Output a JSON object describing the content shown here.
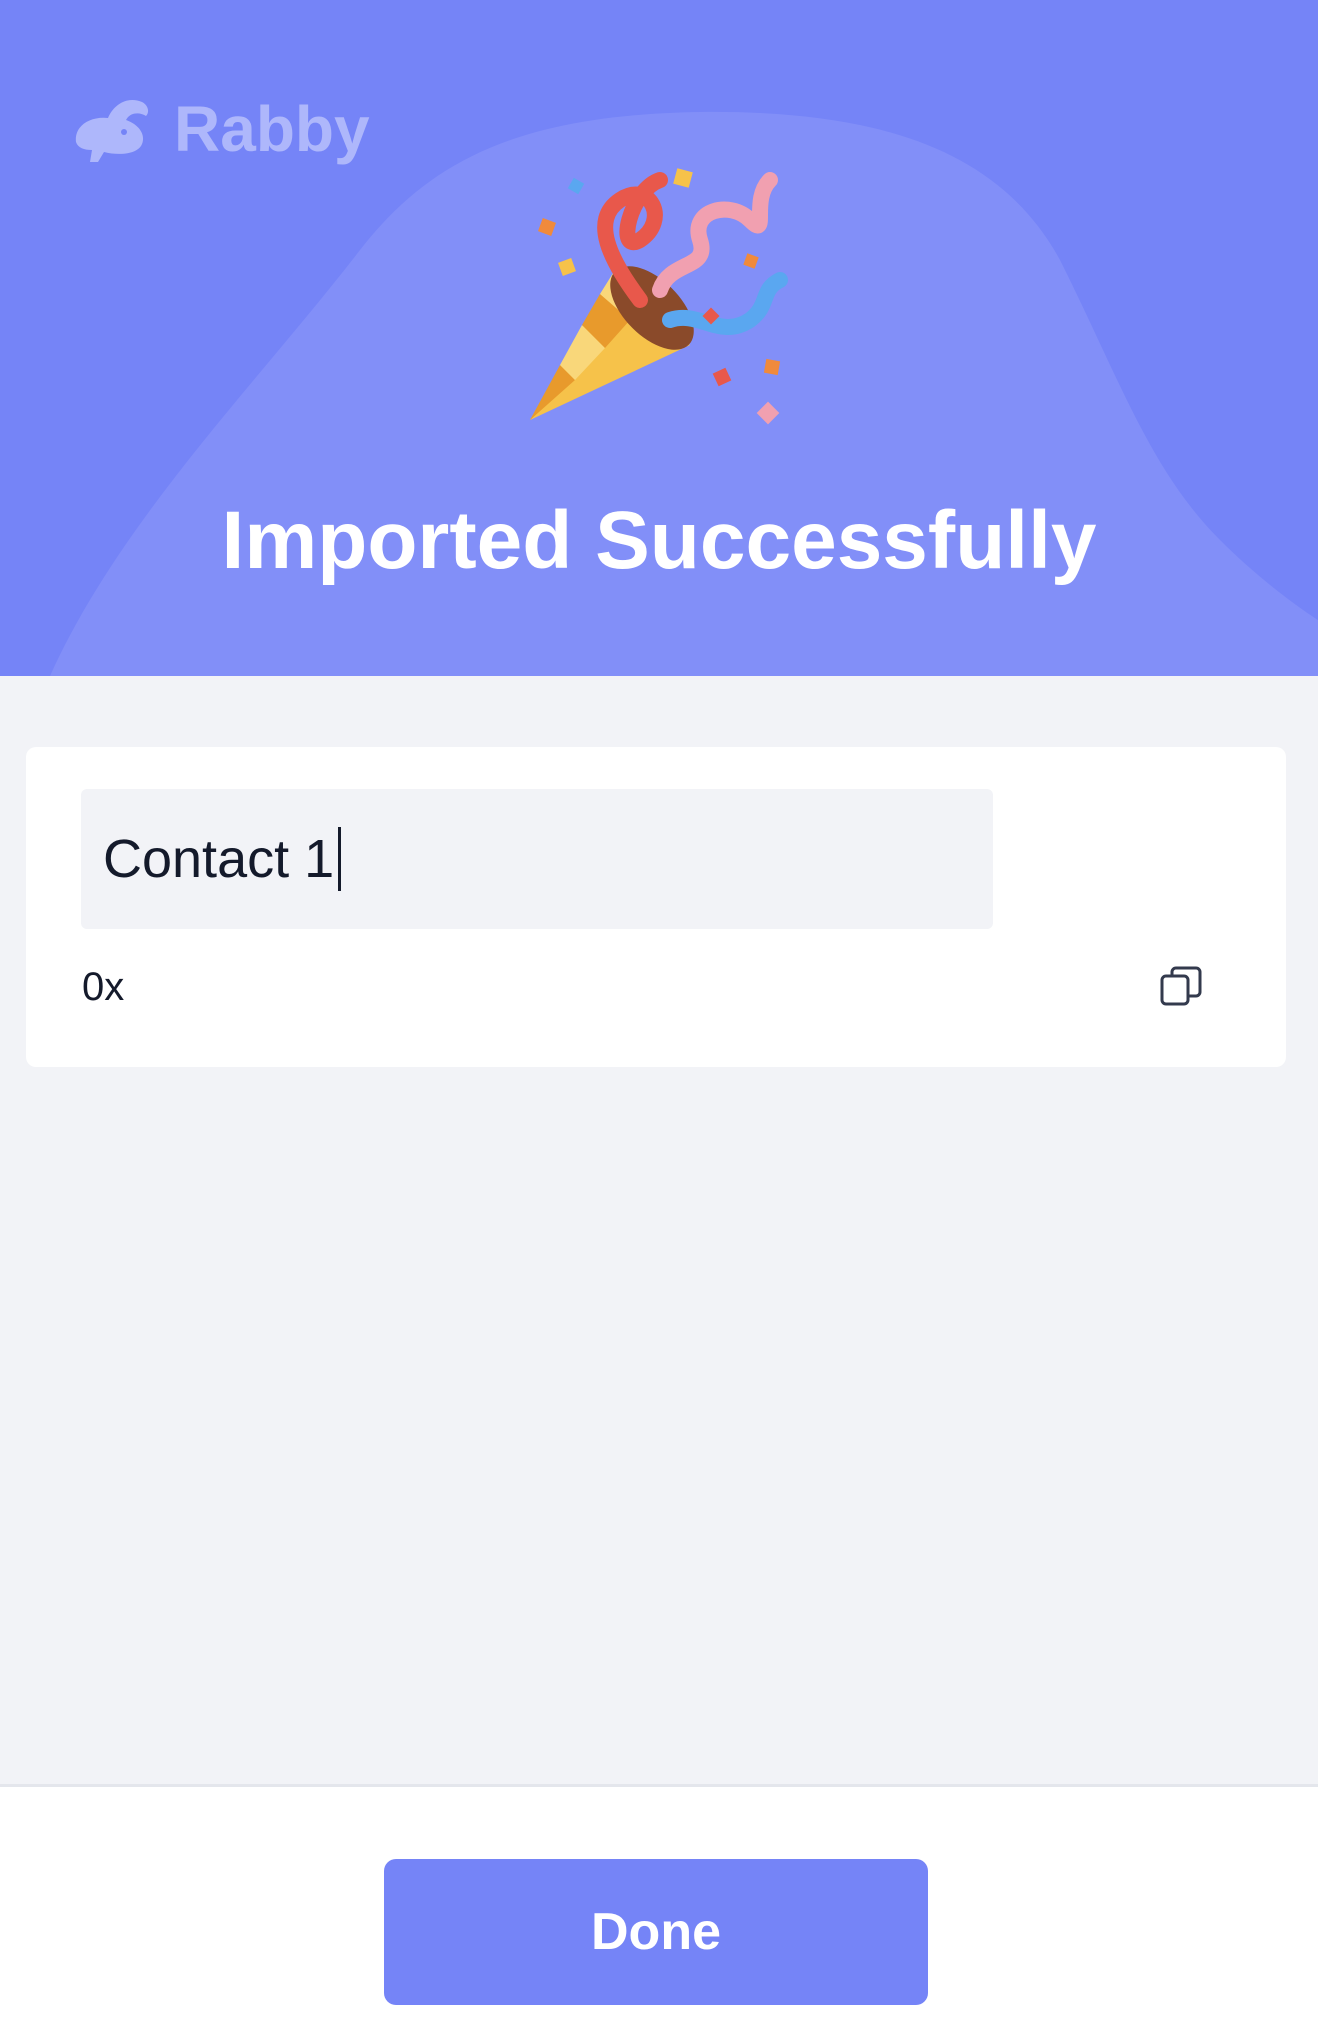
{
  "app": {
    "brand_name": "Rabby",
    "logo_icon": "rabbit-logo-icon"
  },
  "header": {
    "title": "Imported Successfully",
    "illustration_icon": "party-popper-icon"
  },
  "account": {
    "name_value": "Contact 1",
    "address": "0x",
    "copy_icon": "copy-icon"
  },
  "footer": {
    "done_label": "Done"
  },
  "colors": {
    "primary": "#7584f7",
    "brand_text": "#aeb7fb",
    "background": "#f2f3f7",
    "card": "#ffffff",
    "text": "#141a2b"
  }
}
